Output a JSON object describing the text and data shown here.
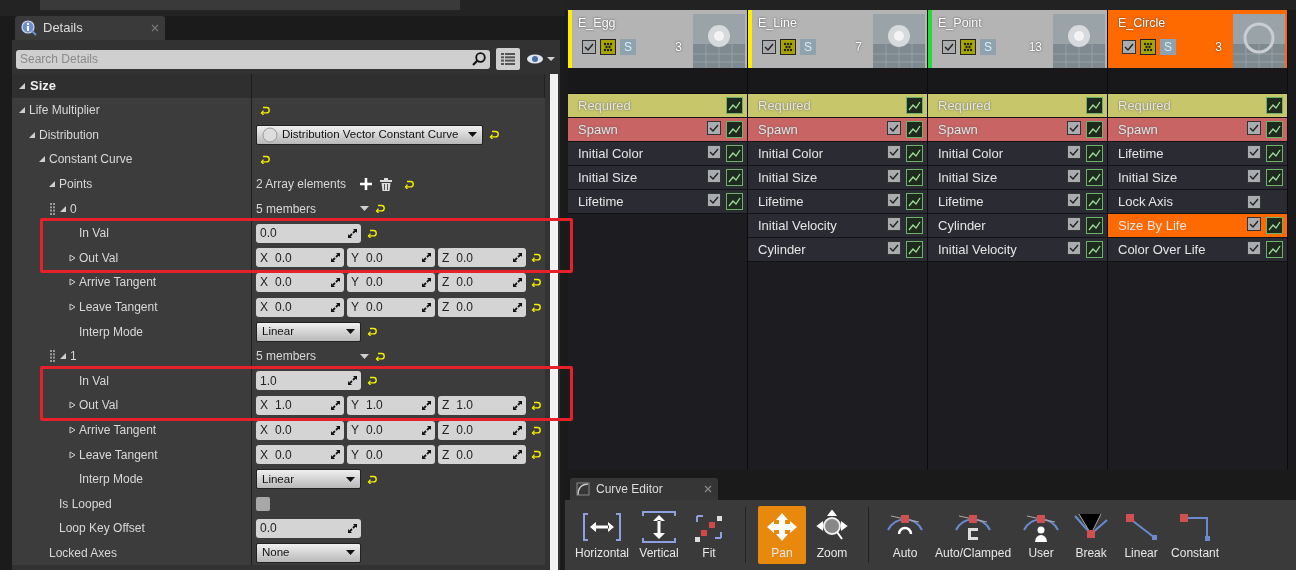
{
  "details_tab": {
    "title": "Details"
  },
  "search": {
    "placeholder": "Search Details"
  },
  "category": {
    "label": "Size",
    "expanded": true
  },
  "rows": [
    {
      "label": "Life Multiplier",
      "expanded": true,
      "kind": "plain",
      "reset": true,
      "children": [
        {
          "label": "Distribution",
          "expanded": true,
          "kind": "dropdown",
          "object": true,
          "text": "Distribution Vector Constant Curve",
          "reset": true,
          "children": [
            {
              "label": "Constant Curve",
              "expanded": true,
              "kind": "plain",
              "reset": true,
              "children": [
                {
                  "label": "Points",
                  "expanded": true,
                  "kind": "array",
                  "text": "2 Array elements",
                  "reset": true,
                  "children": [
                    {
                      "label": "0",
                      "expanded": true,
                      "kind": "members",
                      "text": "5 members",
                      "reset": true,
                      "children": [
                        {
                          "label": "In Val",
                          "kind": "number",
                          "value": "0.0",
                          "reset": true,
                          "highlighted": true
                        },
                        {
                          "label": "Out Val",
                          "expanded": false,
                          "kind": "vector",
                          "components": [
                            {
                              "axis": "X",
                              "value": "0.0"
                            },
                            {
                              "axis": "Y",
                              "value": "0.0"
                            },
                            {
                              "axis": "Z",
                              "value": "0.0"
                            }
                          ],
                          "reset": true,
                          "highlighted": true
                        },
                        {
                          "label": "Arrive Tangent",
                          "expanded": false,
                          "kind": "vector",
                          "components": [
                            {
                              "axis": "X",
                              "value": "0.0"
                            },
                            {
                              "axis": "Y",
                              "value": "0.0"
                            },
                            {
                              "axis": "Z",
                              "value": "0.0"
                            }
                          ],
                          "reset": true,
                          "highlighted": false
                        },
                        {
                          "label": "Leave Tangent",
                          "expanded": false,
                          "kind": "vector",
                          "components": [
                            {
                              "axis": "X",
                              "value": "0.0"
                            },
                            {
                              "axis": "Y",
                              "value": "0.0"
                            },
                            {
                              "axis": "Z",
                              "value": "0.0"
                            }
                          ],
                          "reset": true,
                          "highlighted": false
                        },
                        {
                          "label": "Interp Mode",
                          "kind": "dropdown",
                          "object": false,
                          "text": "Linear",
                          "reset": true,
                          "highlighted": false
                        }
                      ]
                    },
                    {
                      "label": "1",
                      "expanded": true,
                      "kind": "members",
                      "text": "5 members",
                      "reset": true,
                      "children": [
                        {
                          "label": "In Val",
                          "kind": "number",
                          "value": "1.0",
                          "reset": true,
                          "highlighted": true
                        },
                        {
                          "label": "Out Val",
                          "expanded": false,
                          "kind": "vector",
                          "components": [
                            {
                              "axis": "X",
                              "value": "1.0"
                            },
                            {
                              "axis": "Y",
                              "value": "1.0"
                            },
                            {
                              "axis": "Z",
                              "value": "1.0"
                            }
                          ],
                          "reset": true,
                          "highlighted": true
                        },
                        {
                          "label": "Arrive Tangent",
                          "expanded": false,
                          "kind": "vector",
                          "components": [
                            {
                              "axis": "X",
                              "value": "0.0"
                            },
                            {
                              "axis": "Y",
                              "value": "0.0"
                            },
                            {
                              "axis": "Z",
                              "value": "0.0"
                            }
                          ],
                          "reset": true,
                          "highlighted": false
                        },
                        {
                          "label": "Leave Tangent",
                          "expanded": false,
                          "kind": "vector",
                          "components": [
                            {
                              "axis": "X",
                              "value": "0.0"
                            },
                            {
                              "axis": "Y",
                              "value": "0.0"
                            },
                            {
                              "axis": "Z",
                              "value": "0.0"
                            }
                          ],
                          "reset": true,
                          "highlighted": false
                        },
                        {
                          "label": "Interp Mode",
                          "kind": "dropdown",
                          "object": false,
                          "text": "Linear",
                          "reset": true,
                          "highlighted": false
                        }
                      ]
                    }
                  ]
                },
                {
                  "label": "Is Looped",
                  "kind": "checkbox",
                  "checked": false,
                  "reset": false
                },
                {
                  "label": "Loop Key Offset",
                  "kind": "number",
                  "value": "0.0",
                  "reset": false
                }
              ]
            },
            {
              "label": "Locked Axes",
              "kind": "dropdown",
              "object": false,
              "text": "None",
              "reset": false
            }
          ]
        }
      ]
    }
  ],
  "emitters": [
    {
      "name": "E_Egg",
      "color": "#ffee00",
      "checked": true,
      "solo": "S",
      "count": "3",
      "selected": false,
      "modules": [
        {
          "label": "Required",
          "kind": "required",
          "selected": false,
          "curve": true
        },
        {
          "label": "Spawn",
          "kind": "spawn",
          "selected": false,
          "checked": true,
          "curve": true
        },
        {
          "label": "Initial Color",
          "kind": "module",
          "selected": false,
          "checked": true,
          "curve": true
        },
        {
          "label": "Initial Size",
          "kind": "module",
          "selected": false,
          "checked": true,
          "curve": true
        },
        {
          "label": "Lifetime",
          "kind": "module",
          "selected": false,
          "checked": true,
          "curve": true
        }
      ]
    },
    {
      "name": "E_Line",
      "color": "#ffee00",
      "checked": true,
      "solo": "S",
      "count": "7",
      "selected": false,
      "modules": [
        {
          "label": "Required",
          "kind": "required",
          "selected": false,
          "curve": true
        },
        {
          "label": "Spawn",
          "kind": "spawn",
          "selected": false,
          "checked": true,
          "curve": true
        },
        {
          "label": "Initial Color",
          "kind": "module",
          "selected": false,
          "checked": true,
          "curve": true
        },
        {
          "label": "Initial Size",
          "kind": "module",
          "selected": false,
          "checked": true,
          "curve": true
        },
        {
          "label": "Lifetime",
          "kind": "module",
          "selected": false,
          "checked": true,
          "curve": true
        },
        {
          "label": "Initial Velocity",
          "kind": "module",
          "selected": false,
          "checked": true,
          "curve": true
        },
        {
          "label": "Cylinder",
          "kind": "module",
          "selected": false,
          "checked": true,
          "curve": true
        }
      ]
    },
    {
      "name": "E_Point",
      "color": "#22dd33",
      "checked": true,
      "solo": "S",
      "count": "13",
      "selected": false,
      "modules": [
        {
          "label": "Required",
          "kind": "required",
          "selected": false,
          "curve": true
        },
        {
          "label": "Spawn",
          "kind": "spawn",
          "selected": false,
          "checked": true,
          "curve": true
        },
        {
          "label": "Initial Color",
          "kind": "module",
          "selected": false,
          "checked": true,
          "curve": true
        },
        {
          "label": "Initial Size",
          "kind": "module",
          "selected": false,
          "checked": true,
          "curve": true
        },
        {
          "label": "Lifetime",
          "kind": "module",
          "selected": false,
          "checked": true,
          "curve": true
        },
        {
          "label": "Cylinder",
          "kind": "module",
          "selected": false,
          "checked": true,
          "curve": true
        },
        {
          "label": "Initial Velocity",
          "kind": "module",
          "selected": false,
          "checked": true,
          "curve": true
        }
      ]
    },
    {
      "name": "E_Circle",
      "checked": true,
      "solo": "S",
      "count": "3",
      "selected": true,
      "modules": [
        {
          "label": "Required",
          "kind": "required",
          "selected": false,
          "curve": true
        },
        {
          "label": "Spawn",
          "kind": "spawn",
          "selected": false,
          "checked": true,
          "curve": true
        },
        {
          "label": "Lifetime",
          "kind": "module",
          "selected": false,
          "checked": true,
          "curve": true
        },
        {
          "label": "Initial Size",
          "kind": "module",
          "selected": false,
          "checked": true,
          "curve": true
        },
        {
          "label": "Lock Axis",
          "kind": "module",
          "selected": false,
          "checked": true,
          "curve": false
        },
        {
          "label": "Size By Life",
          "kind": "module",
          "selected": true,
          "checked": true,
          "curve": true
        },
        {
          "label": "Color Over Life",
          "kind": "module",
          "selected": false,
          "checked": true,
          "curve": true
        }
      ]
    }
  ],
  "curve_editor": {
    "title": "Curve Editor",
    "groups": [
      {
        "buttons": [
          {
            "label": "Horizontal",
            "selected": false
          },
          {
            "label": "Vertical",
            "selected": false
          },
          {
            "label": "Fit",
            "selected": false
          }
        ]
      },
      {
        "buttons": [
          {
            "label": "Pan",
            "selected": true
          },
          {
            "label": "Zoom",
            "selected": false
          }
        ]
      },
      {
        "buttons": [
          {
            "label": "Auto",
            "selected": false
          },
          {
            "label": "Auto/Clamped",
            "selected": false
          },
          {
            "label": "User",
            "selected": false
          },
          {
            "label": "Break",
            "selected": false
          },
          {
            "label": "Linear",
            "selected": false
          },
          {
            "label": "Constant",
            "selected": false
          }
        ]
      }
    ]
  }
}
